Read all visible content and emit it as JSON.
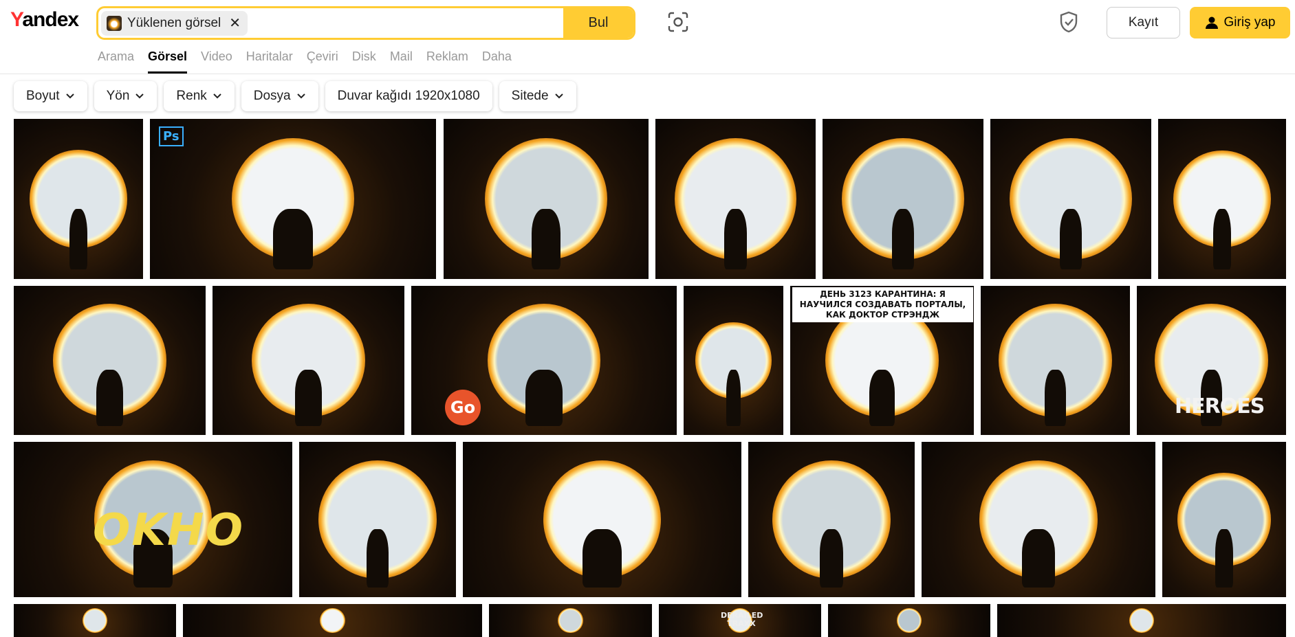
{
  "logo": {
    "first": "Y",
    "rest": "andex"
  },
  "search": {
    "chip_label": "Yüklenen görsel",
    "chip_close": "✕",
    "button": "Bul"
  },
  "header": {
    "register": "Kayıt",
    "login": "Giriş yap"
  },
  "tabs": [
    "Arama",
    "Görsel",
    "Video",
    "Haritalar",
    "Çeviri",
    "Disk",
    "Mail",
    "Reklam",
    "Daha"
  ],
  "active_tab": "Görsel",
  "filters": [
    {
      "label": "Boyut",
      "dropdown": true
    },
    {
      "label": "Yön",
      "dropdown": true
    },
    {
      "label": "Renk",
      "dropdown": true
    },
    {
      "label": "Dosya",
      "dropdown": true
    },
    {
      "label": "Duvar kağıdı 1920x1080",
      "dropdown": false
    },
    {
      "label": "Sitede",
      "dropdown": true
    }
  ],
  "colors": {
    "accent": "#ffcc33",
    "brand_red": "#ff3333",
    "portal_orange": "#f5a623"
  },
  "image_overlays": {
    "ps_badge": "Ps",
    "go_badge": "Go",
    "quarantine_text": "ДЕНЬ 3123 КАРАНТИНА: Я НАУЧИЛСЯ СОЗДАВАТЬ ПОРТАЛЫ, КАК ДОКТОР СТРЭНДЖ",
    "heroes_text": "HEROES",
    "okno_text": "OKHO",
    "derailed_text": "DERAILED TRAXX"
  },
  "result_count": 27
}
